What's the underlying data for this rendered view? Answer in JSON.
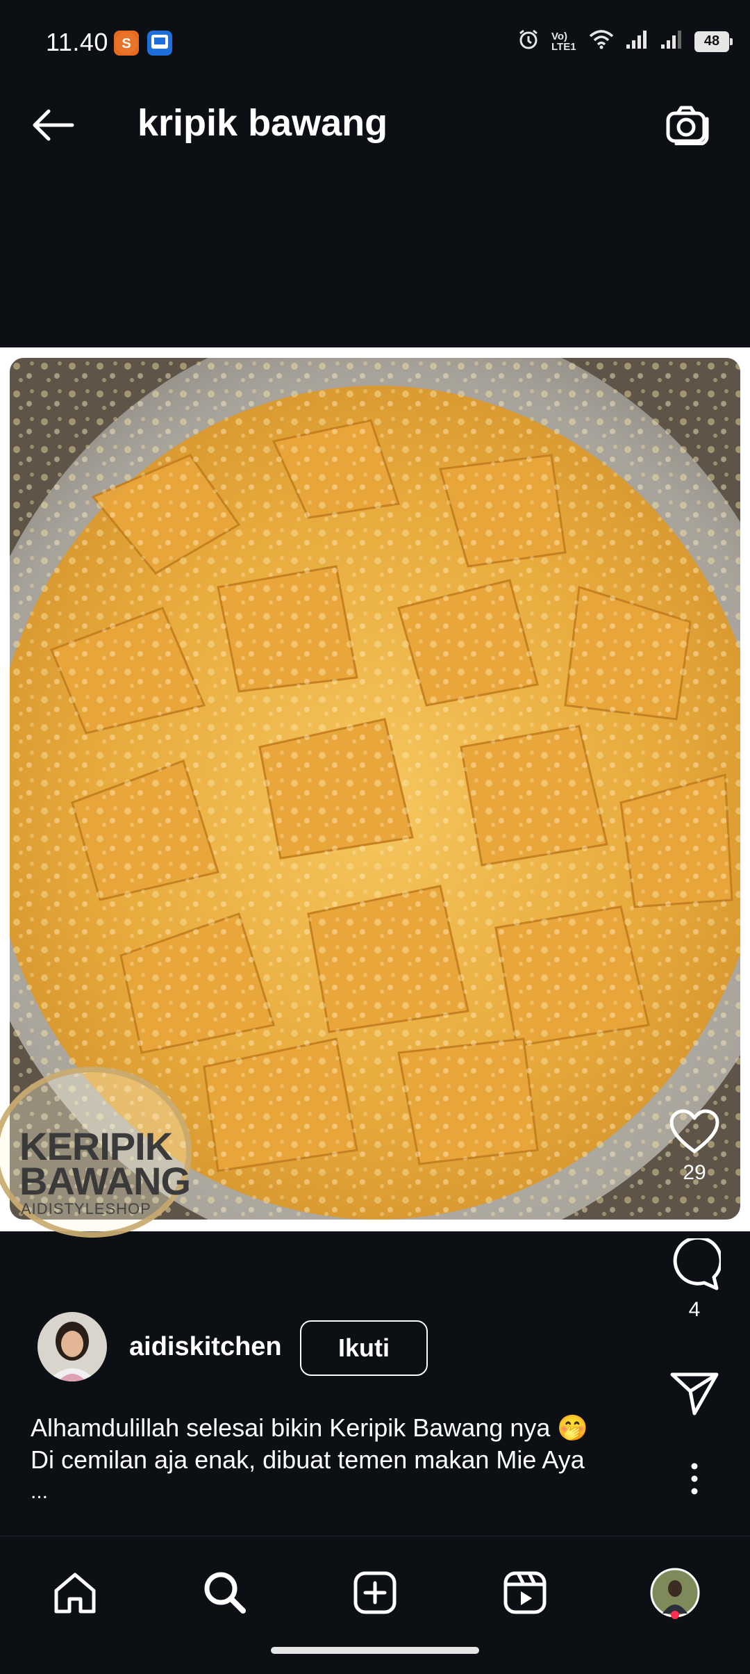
{
  "status_bar": {
    "time": "11.40",
    "battery": "48",
    "network_label": "Vo) LTE1",
    "icons": [
      "shopee-icon",
      "app-notif-icon",
      "alarm-icon",
      "volte-icon",
      "wifi-icon",
      "signal-icon",
      "signal-icon-2",
      "battery-icon"
    ]
  },
  "header": {
    "title": "kripik bawang",
    "back_icon": "back-arrow-icon",
    "camera_icon": "camera-icon"
  },
  "post": {
    "image_overlay_text": {
      "line1": "KERIPIK",
      "line2": "BAWANG",
      "line3": "AIDISTYLESHOP"
    },
    "likes": "29",
    "comments": "4",
    "author": "aidiskitchen",
    "follow_label": "Ikuti",
    "caption_line1": "Alhamdulillah selesai bikin Keripik Bawang nya 🤭",
    "caption_line2": "Di cemilan aja enak, dibuat temen makan Mie Aya",
    "caption_more": "..."
  },
  "bottom_nav": {
    "items": [
      "home-icon",
      "search-icon",
      "create-icon",
      "reels-icon",
      "profile-avatar"
    ]
  },
  "colors": {
    "background": "#0c0f14",
    "text": "#ffffff",
    "notification_dot": "#ff2e50",
    "chip_gold": "#e8b24a"
  }
}
